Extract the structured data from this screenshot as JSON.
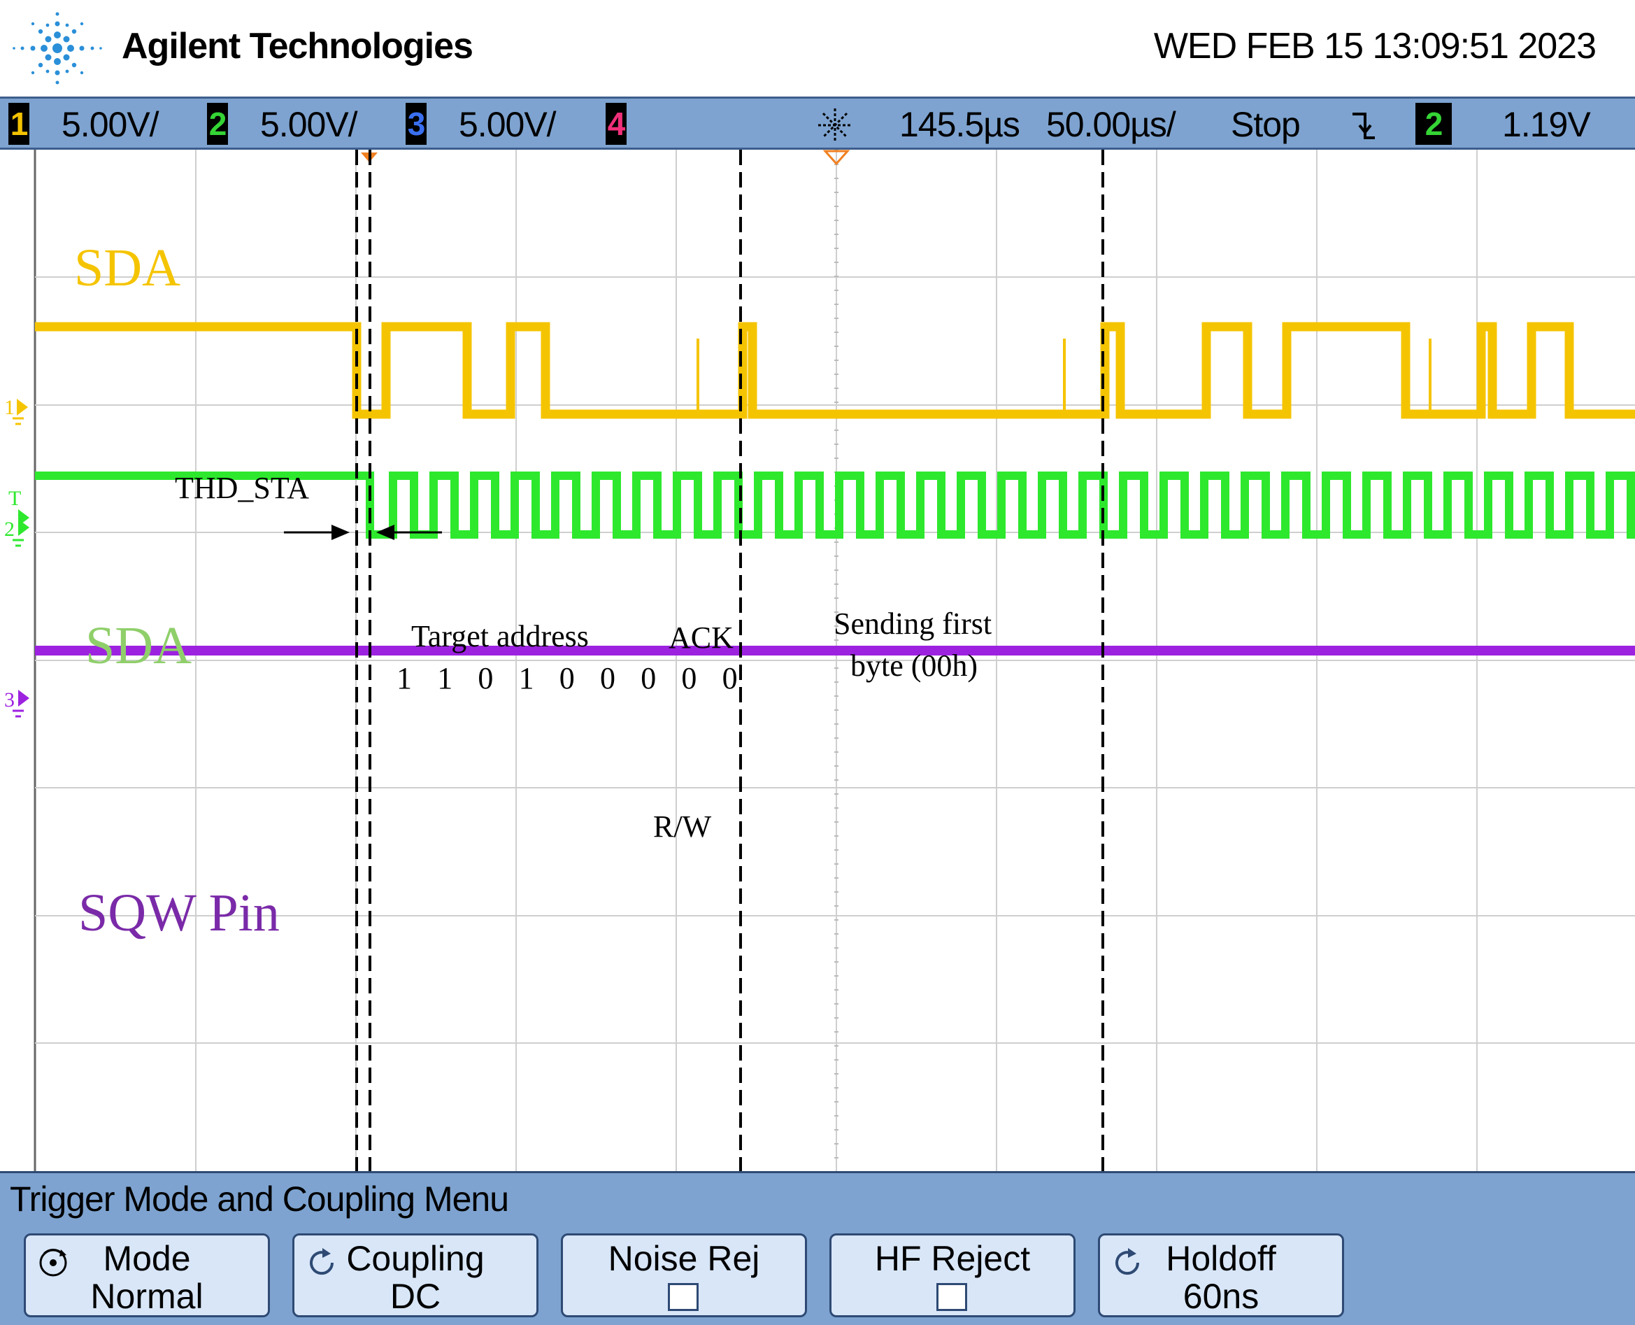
{
  "header": {
    "brand_name": "Agilent Technologies",
    "datetime": "WED FEB 15 13:09:51 2023"
  },
  "status_bar": {
    "channels": [
      {
        "badge": "1",
        "scale": "5.00V/",
        "color": "#f2c200"
      },
      {
        "badge": "2",
        "scale": "5.00V/",
        "color": "#35d435"
      },
      {
        "badge": "3",
        "scale": "5.00V/",
        "color": "#3a6ff0"
      },
      {
        "badge": "4",
        "scale": "",
        "color": "#f0307a"
      }
    ],
    "trigger_delay": "145.5µs",
    "timebase": "50.00µs/",
    "run_state": "Stop",
    "trigger_slope_icon": "falling-edge-icon",
    "trigger_source": "2",
    "trigger_level": "1.19V"
  },
  "screen": {
    "colors": {
      "ch1": "#f5c400",
      "ch2": "#2ee82e",
      "ch3": "#9d22e0",
      "grid": "#cfcfcf"
    },
    "markers": {
      "ch1": "1",
      "trigger": "T",
      "ch2": "2",
      "ch3": "3"
    },
    "annotations": {
      "sda_top": "SDA",
      "sda_bottom": "SDA",
      "sqw_label": "SQW Pin",
      "thd_sta": "THD_STA",
      "target_address": "Target address",
      "address_bits": [
        "1",
        "1",
        "0",
        "1",
        "0",
        "0",
        "0",
        "0",
        "0"
      ],
      "ack": "ACK",
      "rw": "R/W",
      "sending_line1": "Sending first",
      "sending_line2": "byte (00h)"
    }
  },
  "menu": {
    "title": "Trigger Mode and Coupling Menu",
    "softkeys": [
      {
        "line1": "Mode",
        "line2": "Normal",
        "icon": "rotate-knob-icon"
      },
      {
        "line1": "Coupling",
        "line2": "DC",
        "icon": "rotate-arrow-icon"
      },
      {
        "line1": "Noise Rej",
        "line2": "",
        "icon": "checkbox-icon"
      },
      {
        "line1": "HF Reject",
        "line2": "",
        "icon": "checkbox-icon"
      },
      {
        "line1": "Holdoff",
        "line2": "60ns",
        "icon": "rotate-arrow-icon"
      }
    ]
  }
}
